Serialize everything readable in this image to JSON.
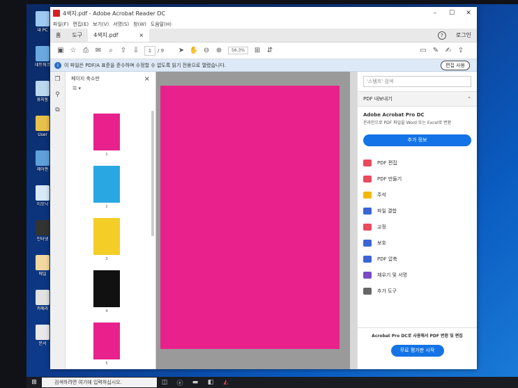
{
  "desktop_icons": [
    {
      "label": "내 PC",
      "color": "#9ec9f0"
    },
    {
      "label": "네트워크",
      "color": "#6aa9e0"
    },
    {
      "label": "휴지통",
      "color": "#bcd8f0"
    },
    {
      "label": "User",
      "color": "#e8c14a"
    },
    {
      "label": "제어판",
      "color": "#5fa0d8"
    },
    {
      "label": "이오닉",
      "color": "#d9e9f7"
    },
    {
      "label": "인터넷",
      "color": "#333333"
    },
    {
      "label": "메일",
      "color": "#f2d8a0"
    },
    {
      "label": "카메라",
      "color": "#e2e2e2"
    },
    {
      "label": "문서",
      "color": "#e8e8e8"
    }
  ],
  "window": {
    "title": "4색지.pdf - Adobe Acrobat Reader DC",
    "minimize": "–",
    "maximize": "☐",
    "close": "✕"
  },
  "menu": [
    "파일(F)",
    "편집(E)",
    "보기(V)",
    "서명(S)",
    "창(W)",
    "도움말(H)"
  ],
  "tabs": {
    "home": "홈",
    "tools": "도구",
    "doc_tab": "4색지.pdf",
    "doc_close": "×",
    "help": "?",
    "login": "로그인"
  },
  "toolbar": {
    "page_current": "1",
    "page_total": "/ 9",
    "zoom": "56.3%"
  },
  "infobar": {
    "text": "이 파일은 PDF/A 표준을 준수하며 수정할 수 없도록 읽기 전용으로 열렸습니다.",
    "edit_button": "편집 사용"
  },
  "thumbnails_panel": {
    "title": "페이지 축소판",
    "close": "×",
    "options": "☰ ▾",
    "pages": [
      {
        "num": "1",
        "color": "#e8218c"
      },
      {
        "num": "2",
        "color": "#29a7e3"
      },
      {
        "num": "3",
        "color": "#f4cd26"
      },
      {
        "num": "4",
        "color": "#111111"
      },
      {
        "num": "5",
        "color": "#e8218c"
      }
    ]
  },
  "right_panel": {
    "search_placeholder": "'스탬프' 검색",
    "export_label": "PDF 내보내기",
    "promo_title": "Adobe Acrobat Pro DC",
    "promo_desc": "온라인으로 PDF 파일을 Word 또는 Excel로 변환",
    "promo_button": "추가 정보",
    "tools": [
      {
        "label": "PDF 편집",
        "color": "#e84a5f"
      },
      {
        "label": "PDF 만들기",
        "color": "#e84a5f"
      },
      {
        "label": "주석",
        "color": "#f2b900"
      },
      {
        "label": "파일 결합",
        "color": "#3b64d6"
      },
      {
        "label": "교정",
        "color": "#e84a5f"
      },
      {
        "label": "보호",
        "color": "#3b64d6"
      },
      {
        "label": "PDF 압축",
        "color": "#3b64d6"
      },
      {
        "label": "채우기 및 서명",
        "color": "#7b4bc4"
      },
      {
        "label": "추가 도구",
        "color": "#666666"
      }
    ],
    "footer_text": "Acrobat Pro DC로 사용해서 PDF 변환 및 편집",
    "footer_button": "무료 평가판 시작"
  },
  "taskbar": {
    "search_placeholder": "검색하려면 여기에 입력하십시오."
  }
}
